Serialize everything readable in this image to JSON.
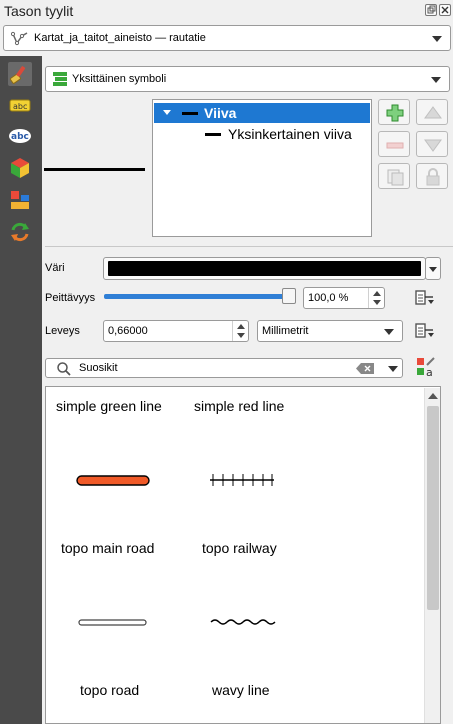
{
  "panel": {
    "title": "Tason tyylit"
  },
  "layer": {
    "name": "Kartat_ja_taitot_aineisto — rautatie"
  },
  "renderer": {
    "label": "Yksittäinen symboli"
  },
  "symbol_tree": {
    "items": [
      {
        "label": "Viiva",
        "selected": true
      },
      {
        "label": "Yksinkertainen viiva",
        "selected": false
      }
    ]
  },
  "properties": {
    "color_label": "Väri",
    "color_value": "#000000",
    "opacity_label": "Peittävyys",
    "opacity_value": "100,0 %",
    "opacity_fraction": 1.0,
    "width_label": "Leveys",
    "width_value": "0,66000",
    "unit_value": "Millimetrit"
  },
  "library": {
    "filter_value": "Suosikit",
    "items": [
      {
        "label": "simple green line"
      },
      {
        "label": "simple red line"
      },
      {
        "label": "topo main road"
      },
      {
        "label": "topo railway"
      },
      {
        "label": "topo road"
      },
      {
        "label": "wavy line"
      }
    ]
  },
  "colors": {
    "selection": "#1e78d2",
    "slider": "#2f7fd6",
    "sidebar": "#4a4a4a",
    "topo_main_road": "#f05a28"
  },
  "icons": {
    "toolbar": [
      "paint-brush-icon",
      "label-icon",
      "abc-icon",
      "3d-cube-icon",
      "diagram-icon",
      "history-icon"
    ],
    "tree_buttons": [
      "add-symbol-icon",
      "remove-symbol-icon",
      "move-up-icon",
      "move-down-icon",
      "duplicate-icon",
      "lock-icon"
    ]
  }
}
